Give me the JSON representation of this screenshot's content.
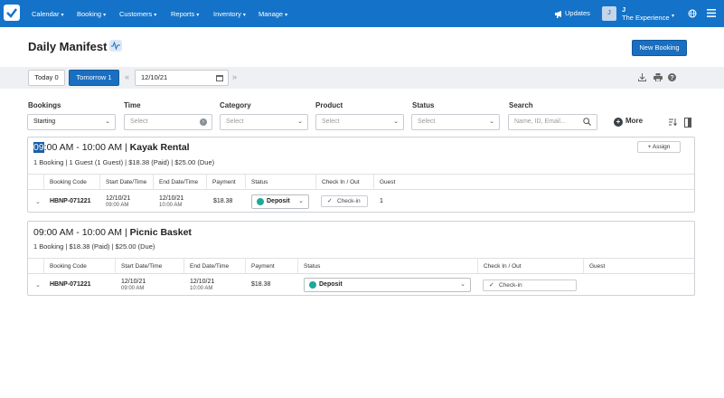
{
  "nav": {
    "items": [
      "Calendar",
      "Booking",
      "Customers",
      "Reports",
      "Inventory",
      "Manage"
    ],
    "updates_label": "Updates",
    "account_initial": "J",
    "account_name": "J",
    "account_company": "The Experience",
    "accent_color": "#1473c9"
  },
  "header": {
    "title": "Daily Manifest",
    "new_booking_label": "New Booking"
  },
  "toolbar": {
    "today_label": "Today 0",
    "tomorrow_label": "Tomorrow 1",
    "prev_symbol": "«",
    "next_symbol": "»",
    "date_value": "12/10/21",
    "icons": [
      "download-icon",
      "print-icon",
      "help-icon"
    ]
  },
  "filters": {
    "bookings_label": "Bookings",
    "bookings_value": "Starting",
    "time_label": "Time",
    "time_placeholder": "Select",
    "category_label": "Category",
    "category_placeholder": "Select",
    "product_label": "Product",
    "product_placeholder": "Select",
    "status_label": "Status",
    "status_placeholder": "Select",
    "search_label": "Search",
    "search_placeholder": "Name, ID, Email...",
    "more_label": "More"
  },
  "manifests": [
    {
      "time_hl": "09",
      "time_rest": ":00 AM - 10:00 AM",
      "separator": " | ",
      "product": "Kayak Rental",
      "summary": "1 Booking   |   1 Guest (1 Guest)   |   $18.38 (Paid)   |   $25.00 (Due)",
      "assign_label": "+ Assign",
      "columns": [
        "Booking Code",
        "Start Date/Time",
        "End Date/Time",
        "Payment",
        "Status",
        "Check In / Out",
        "Guest"
      ],
      "rows": [
        {
          "code": "HBNP-071221",
          "start_date": "12/10/21",
          "start_time": "09:00 AM",
          "end_date": "12/10/21",
          "end_time": "10:00 AM",
          "payment": "$18.38",
          "status": "Deposit",
          "checkin": "Check-in",
          "guest": "1"
        }
      ]
    },
    {
      "time": "09:00 AM - 10:00 AM",
      "separator": " | ",
      "product": "Picnic Basket",
      "summary": "1 Booking   |   $18.38 (Paid)   |   $25.00 (Due)",
      "columns": [
        "Booking Code",
        "Start Date/Time",
        "End Date/Time",
        "Payment",
        "Status",
        "Check In / Out",
        "Guest"
      ],
      "rows": [
        {
          "code": "HBNP-071221",
          "start_date": "12/10/21",
          "start_time": "09:00 AM",
          "end_date": "12/10/21",
          "end_time": "10:00 AM",
          "payment": "$18.38",
          "status": "Deposit",
          "checkin": "Check-in"
        }
      ]
    }
  ],
  "status_color": "#1fa89a"
}
